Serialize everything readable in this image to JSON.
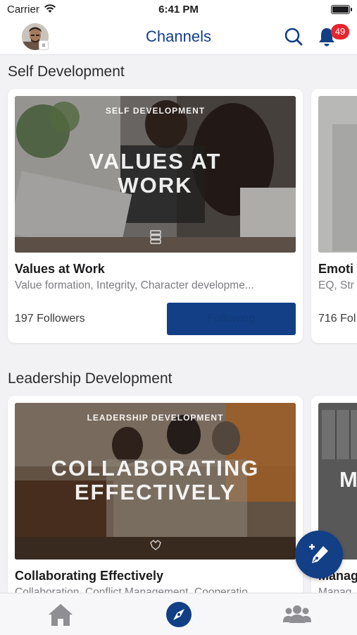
{
  "status_bar": {
    "carrier": "Carrier",
    "time": "6:41 PM"
  },
  "nav": {
    "title": "Channels",
    "notification_count": "49",
    "accent_color": "#123f86",
    "badge_color": "#e8252e"
  },
  "sections": [
    {
      "title": "Self Development",
      "cards": [
        {
          "image_category": "SELF DEVELOPMENT",
          "image_title_line1": "VALUES AT",
          "image_title_line2": "WORK",
          "title": "Values at Work",
          "tags": "Value formation, Integrity, Character developme...",
          "followers": "197 Followers",
          "button_label": "Following"
        },
        {
          "title": "Emoti",
          "tags": "EQ, Str",
          "followers": "716 Fol"
        }
      ]
    },
    {
      "title": "Leadership Development",
      "cards": [
        {
          "image_category": "LEADERSHIP DEVELOPMENT",
          "image_title_line1": "COLLABORATING",
          "image_title_line2": "EFFECTIVELY",
          "title": "Collaborating Effectively",
          "tags": "Collaboration, Conflict Management, Cooperatio..."
        },
        {
          "image_title_line1": "M",
          "title": "Manag",
          "tags": "Manag"
        }
      ]
    }
  ],
  "icons": {
    "wifi": "wifi-icon",
    "battery": "battery-icon",
    "search": "search-icon",
    "bell": "bell-icon",
    "compose": "compose-pen-icon",
    "home": "home-icon",
    "explore": "compass-icon",
    "community": "people-icon"
  }
}
